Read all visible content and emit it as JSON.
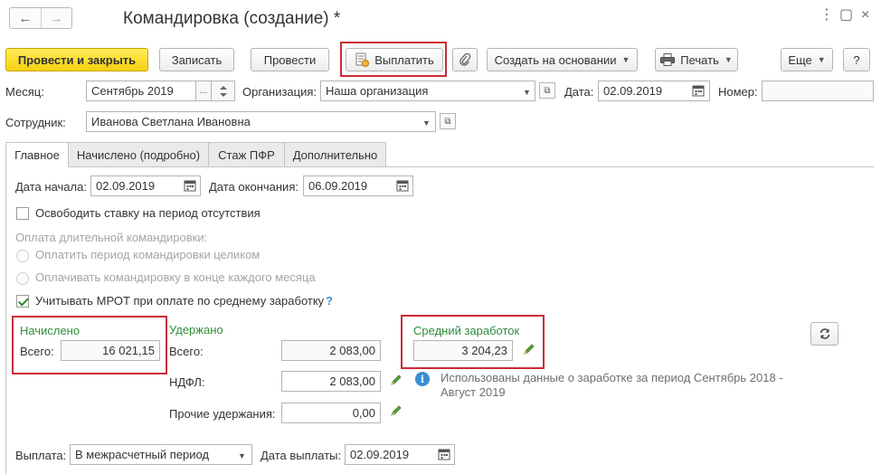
{
  "window": {
    "title": "Командировка (создание) *",
    "more_icon": "more-vertical-icon",
    "maximize_icon": "maximize-icon",
    "close_icon": "close-icon"
  },
  "nav": {
    "back_icon": "arrow-left-icon",
    "forward_icon": "arrow-right-icon"
  },
  "toolbar": {
    "post_close": "Провести и закрыть",
    "save": "Записать",
    "post": "Провести",
    "pay": "Выплатить",
    "create_based": "Создать на основании",
    "print": "Печать",
    "more": "Еще",
    "help": "?"
  },
  "header": {
    "month_label": "Месяц:",
    "month_value": "Сентябрь 2019",
    "org_label": "Организация:",
    "org_value": "Наша организация",
    "date_label": "Дата:",
    "date_value": "02.09.2019",
    "number_label": "Номер:",
    "number_value": "",
    "employee_label": "Сотрудник:",
    "employee_value": "Иванова Светлана Ивановна"
  },
  "tabs": [
    {
      "label": "Главное",
      "active": true
    },
    {
      "label": "Начислено (подробно)",
      "active": false
    },
    {
      "label": "Стаж ПФР",
      "active": false
    },
    {
      "label": "Дополнительно",
      "active": false
    }
  ],
  "main": {
    "start_label": "Дата начала:",
    "start_value": "02.09.2019",
    "end_label": "Дата окончания:",
    "end_value": "06.09.2019",
    "release_rate_label": "Освободить ставку на период отсутствия",
    "release_rate_checked": false,
    "long_trip_label": "Оплата длительной командировки:",
    "pay_whole_label": "Оплатить период командировки целиком",
    "pay_monthly_label": "Оплачивать командировку в конце каждого месяца",
    "mrot_label": "Учитывать МРОТ при оплате по среднему заработку",
    "mrot_checked": true,
    "mrot_help": "?"
  },
  "accrued": {
    "title": "Начислено",
    "total_label": "Всего:",
    "total_value": "16 021,15"
  },
  "withheld": {
    "title": "Удержано",
    "total_label": "Всего:",
    "total_value": "2 083,00",
    "ndfl_label": "НДФЛ:",
    "ndfl_value": "2 083,00",
    "other_label": "Прочие удержания:",
    "other_value": "0,00"
  },
  "average": {
    "title": "Средний заработок",
    "value": "3 204,23",
    "info": "Использованы данные о заработке за период Сентябрь 2018 - Август 2019"
  },
  "payment": {
    "label": "Выплата:",
    "value": "В межрасчетный период",
    "date_label": "Дата выплаты:",
    "date_value": "02.09.2019"
  },
  "colors": {
    "accent_yellow": "#f5d10e",
    "highlight_red": "#cc2b36",
    "section_green": "#2e8b3a",
    "info_blue": "#3b8dd3"
  }
}
